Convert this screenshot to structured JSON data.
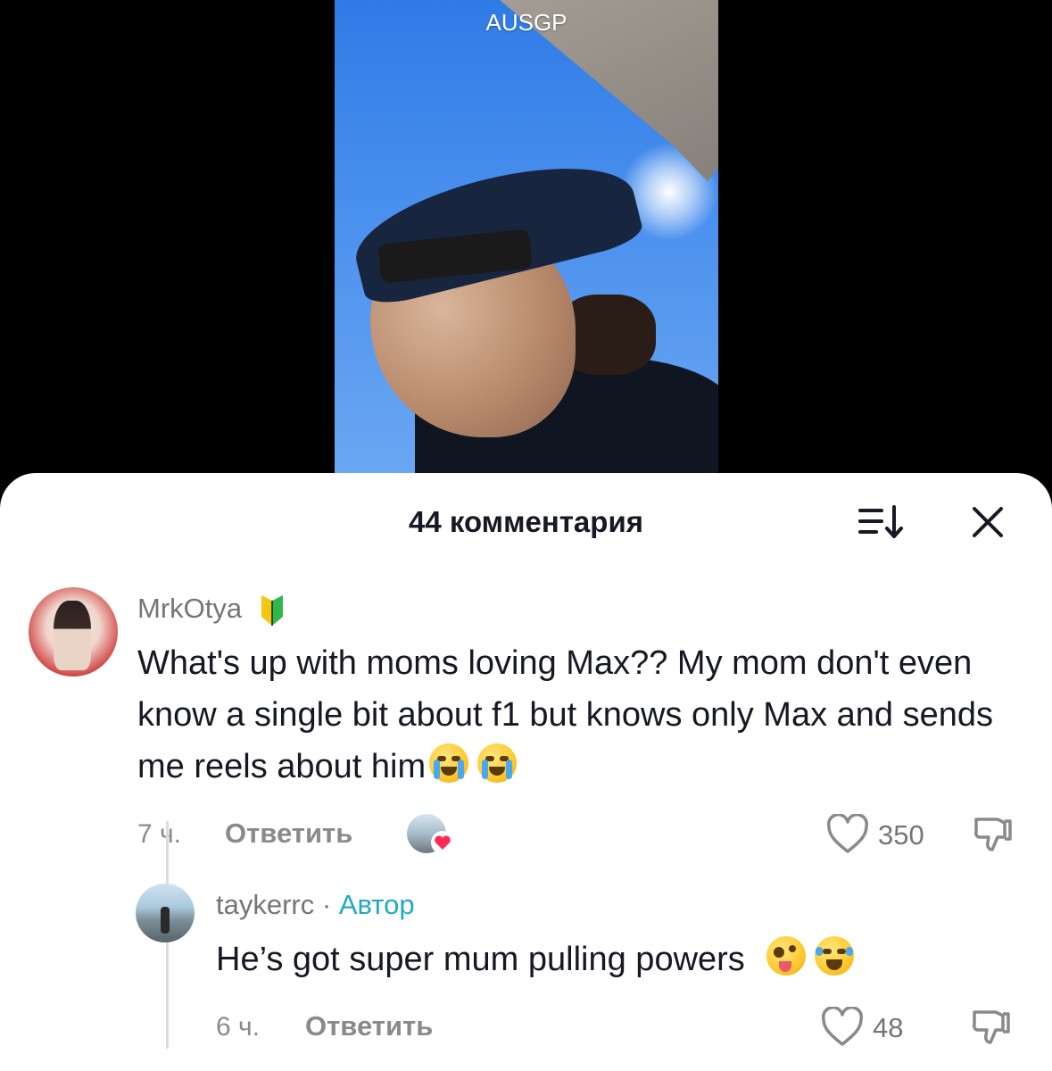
{
  "video": {
    "caption": "AUSGP"
  },
  "sheet": {
    "title": "44 комментария"
  },
  "comments": [
    {
      "username": "MrkOtya",
      "badge_icon": "beginner-badge-icon",
      "text": "What's up with moms loving Max?? My mom don't even know a single bit about f1 but knows only Max and sends me reels about him",
      "emojis": [
        "loudly-crying-face-icon",
        "loudly-crying-face-icon"
      ],
      "time": "7 ч.",
      "reply_label": "Ответить",
      "liked_by_creator": true,
      "likes": "350"
    },
    {
      "username": "taykerrc",
      "separator": "·",
      "author_label": "Автор",
      "text": "He’s got super mum pulling powers",
      "emojis": [
        "zany-face-icon",
        "tears-of-joy-icon"
      ],
      "time": "6 ч.",
      "reply_label": "Ответить",
      "likes": "48"
    }
  ],
  "colors": {
    "author_accent": "#20a9c4",
    "heart_accent": "#fe2c55",
    "text_primary": "#161823",
    "text_secondary": "#8a8a8a"
  }
}
